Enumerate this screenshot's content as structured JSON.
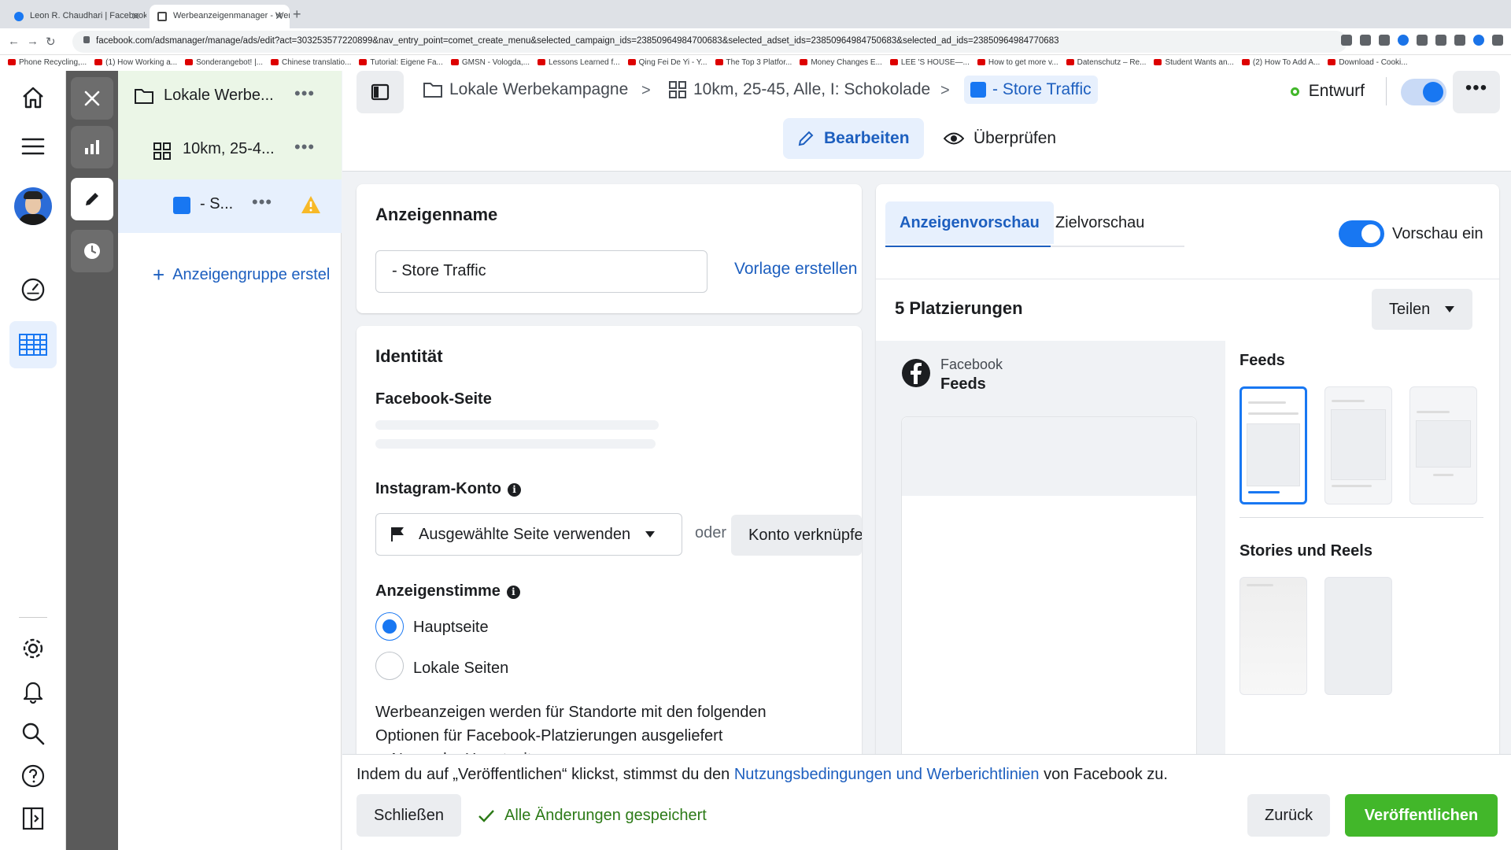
{
  "browser": {
    "tabs": [
      {
        "title": "Leon R. Chaudhari | Facebook"
      },
      {
        "title": "Werbeanzeigenmanager - Wer"
      }
    ],
    "url": "facebook.com/adsmanager/manage/ads/edit?act=303253577220899&nav_entry_point=comet_create_menu&selected_campaign_ids=23850964984700683&selected_adset_ids=23850964984750683&selected_ad_ids=23850964984770683",
    "bookmarks": [
      "Phone Recycling,...",
      "(1) How Working a...",
      "Sonderangebot! |...",
      "Chinese translatio...",
      "Tutorial: Eigene Fa...",
      "GMSN - Vologda,...",
      "Lessons Learned f...",
      "Qing Fei De Yi - Y...",
      "The Top 3 Platfor...",
      "Money Changes E...",
      "LEE 'S HOUSE—...",
      "How to get more v...",
      "Datenschutz – Re...",
      "Student Wants an...",
      "(2) How To Add A...",
      "Download - Cooki..."
    ]
  },
  "tree": {
    "campaign_label": "Lokale Werbe...",
    "adset_label": "10km, 25-4...",
    "ad_label": "- S...",
    "create_label": "Anzeigengruppe erstel"
  },
  "topbar": {
    "crumbs": [
      "Lokale Werbekampagne",
      "10km, 25-45, Alle, I: Schokolade",
      "- Store Traffic"
    ],
    "status": "Entwurf",
    "edit_label": "Bearbeiten",
    "review_label": "Überprüfen",
    "more": "•••"
  },
  "adname": {
    "heading": "Anzeigenname",
    "value": "- Store Traffic",
    "template_link": "Vorlage erstellen"
  },
  "identity": {
    "heading": "Identität",
    "fb_page_label": "Facebook-Seite",
    "ig_label": "Instagram-Konto",
    "ig_select": "Ausgewählte Seite verwenden",
    "or": "oder",
    "connect": "Konto verknüpfen",
    "voice_label": "Anzeigenstimme",
    "radio1": "Hauptseite",
    "radio2": "Lokale Seiten",
    "para1": "Werbeanzeigen werden für Standorte mit den folgenden Optionen für Facebook-Platzierungen ausgeliefert",
    "bullet1": "• Name der Hauptseite"
  },
  "preview": {
    "tab1": "Anzeigenvorschau",
    "tab2": "Zielvorschau",
    "toggle_label": "Vorschau ein",
    "placements_title": "5 Platzierungen",
    "share": "Teilen",
    "platform": "Facebook",
    "platform_sub": "Feeds",
    "feeds_heading": "Feeds",
    "stories_heading": "Stories und Reels"
  },
  "footer": {
    "terms_pre": "Indem du auf „Veröffentlichen“ klickst, stimmst du den ",
    "terms_link": "Nutzungsbedingungen und Werberichtlinien",
    "terms_post": " von Facebook zu.",
    "close": "Schließen",
    "saved": "Alle Änderungen gespeichert",
    "back": "Zurück",
    "publish": "Veröffentlichen"
  },
  "colors": {
    "accent": "#1877f2",
    "link": "#1d5fbf",
    "publish": "#42b72a",
    "warning": "#f7b928"
  }
}
